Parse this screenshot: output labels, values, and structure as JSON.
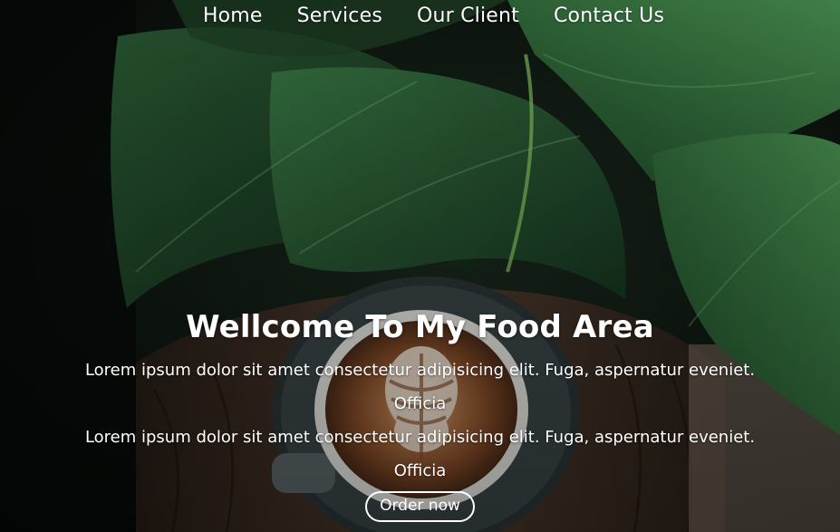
{
  "nav": {
    "items": [
      {
        "label": "Home"
      },
      {
        "label": "Services"
      },
      {
        "label": "Our Client"
      },
      {
        "label": "Contact Us"
      }
    ]
  },
  "hero": {
    "title": "Wellcome To My Food Area",
    "paragraphs": [
      "Lorem ipsum dolor sit amet consectetur adipisicing elit. Fuga, aspernatur eveniet. Officia",
      "Lorem ipsum dolor sit amet consectetur adipisicing elit. Fuga, aspernatur eveniet. Officia"
    ],
    "button_label": "Order now"
  },
  "colors": {
    "text": "#ffffff",
    "background_dark": "#0b0f0c",
    "leaf_green": "#2f6a3a",
    "coffee_brown": "#6b3f22",
    "saucer_gray": "#3c4648"
  },
  "icons": {
    "background": "monstera-leaves-coffee-latte-photo"
  }
}
